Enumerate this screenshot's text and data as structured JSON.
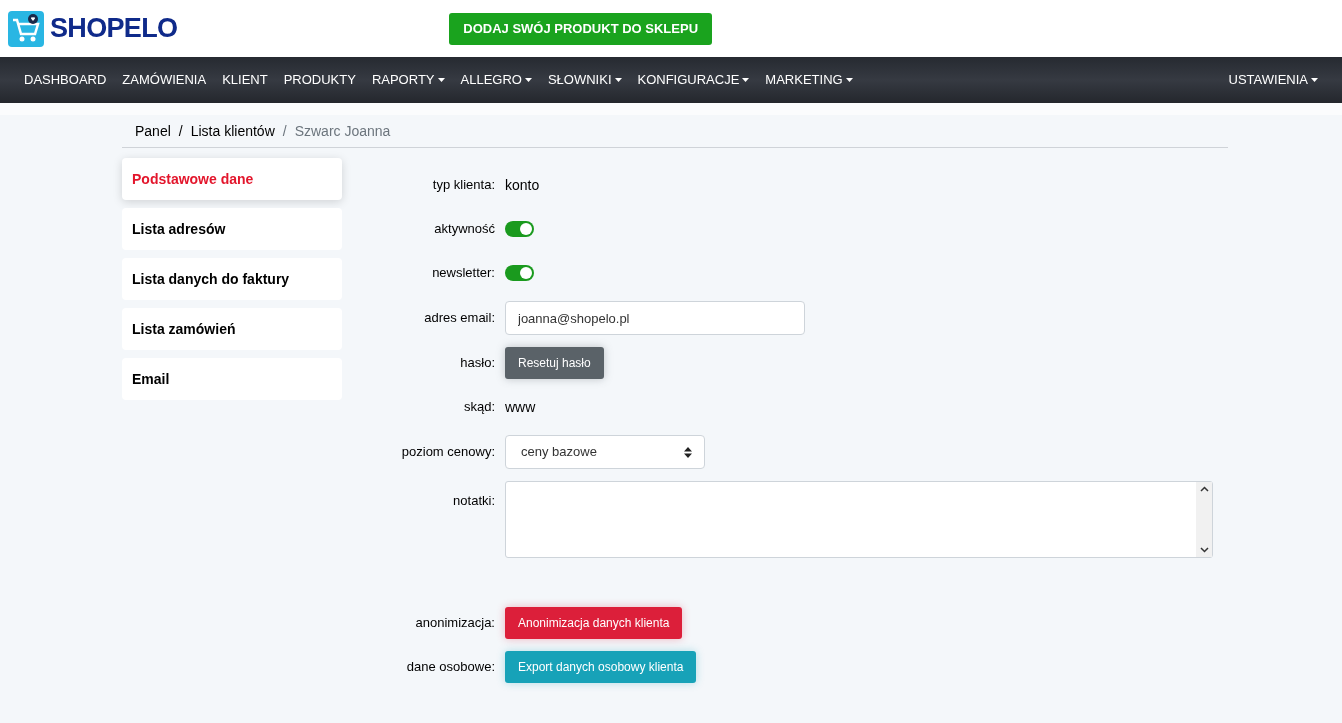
{
  "header": {
    "logo": "SHOPELO",
    "cta": "DODAJ SWÓJ PRODUKT DO SKLEPU"
  },
  "nav": {
    "items": [
      {
        "label": "DASHBOARD",
        "dropdown": false
      },
      {
        "label": "ZAMÓWIENIA",
        "dropdown": false
      },
      {
        "label": "KLIENT",
        "dropdown": false
      },
      {
        "label": "PRODUKTY",
        "dropdown": false
      },
      {
        "label": "RAPORTY",
        "dropdown": true
      },
      {
        "label": "ALLEGRO",
        "dropdown": true
      },
      {
        "label": "SŁOWNIKI",
        "dropdown": true
      },
      {
        "label": "KONFIGURACJE",
        "dropdown": true
      },
      {
        "label": "MARKETING",
        "dropdown": true
      }
    ],
    "right": {
      "label": "USTAWIENIA",
      "dropdown": true
    }
  },
  "breadcrumb": [
    {
      "label": "Panel"
    },
    {
      "separator": "/",
      "label": "Lista klientów"
    },
    {
      "separator": "/",
      "label": "Szwarc Joanna"
    }
  ],
  "sidebar": {
    "items": [
      {
        "label": "Podstawowe dane",
        "selected": true
      },
      {
        "label": "Lista adresów",
        "selected": false
      },
      {
        "label": "Lista danych do faktury",
        "selected": false
      },
      {
        "label": "Lista zamówień",
        "selected": false
      },
      {
        "label": "Email",
        "selected": false
      }
    ]
  },
  "form": {
    "rows": [
      {
        "kind": "text",
        "label": "typ klienta:",
        "value": "konto"
      },
      {
        "kind": "toggle",
        "label": "aktywność",
        "on": true
      },
      {
        "kind": "toggle",
        "label": "newsletter:",
        "on": true
      },
      {
        "kind": "input",
        "label": "adres email:",
        "value": "joanna@shopelo.pl"
      },
      {
        "kind": "resetbutton",
        "label": "hasło:",
        "button": "Resetuj hasło"
      },
      {
        "kind": "text",
        "label": "skąd:",
        "value": "www"
      },
      {
        "kind": "select",
        "label": "poziom cenowy:",
        "value": "ceny bazowe"
      },
      {
        "kind": "textarea",
        "label": "notatki:"
      },
      {
        "kind": "dangerbutton",
        "label": "anonimizacja:",
        "button": "Anonimizacja danych klienta"
      },
      {
        "kind": "exportbutton",
        "label": "dane osobowe:",
        "button": "Export danych osobowy klienta"
      }
    ]
  }
}
